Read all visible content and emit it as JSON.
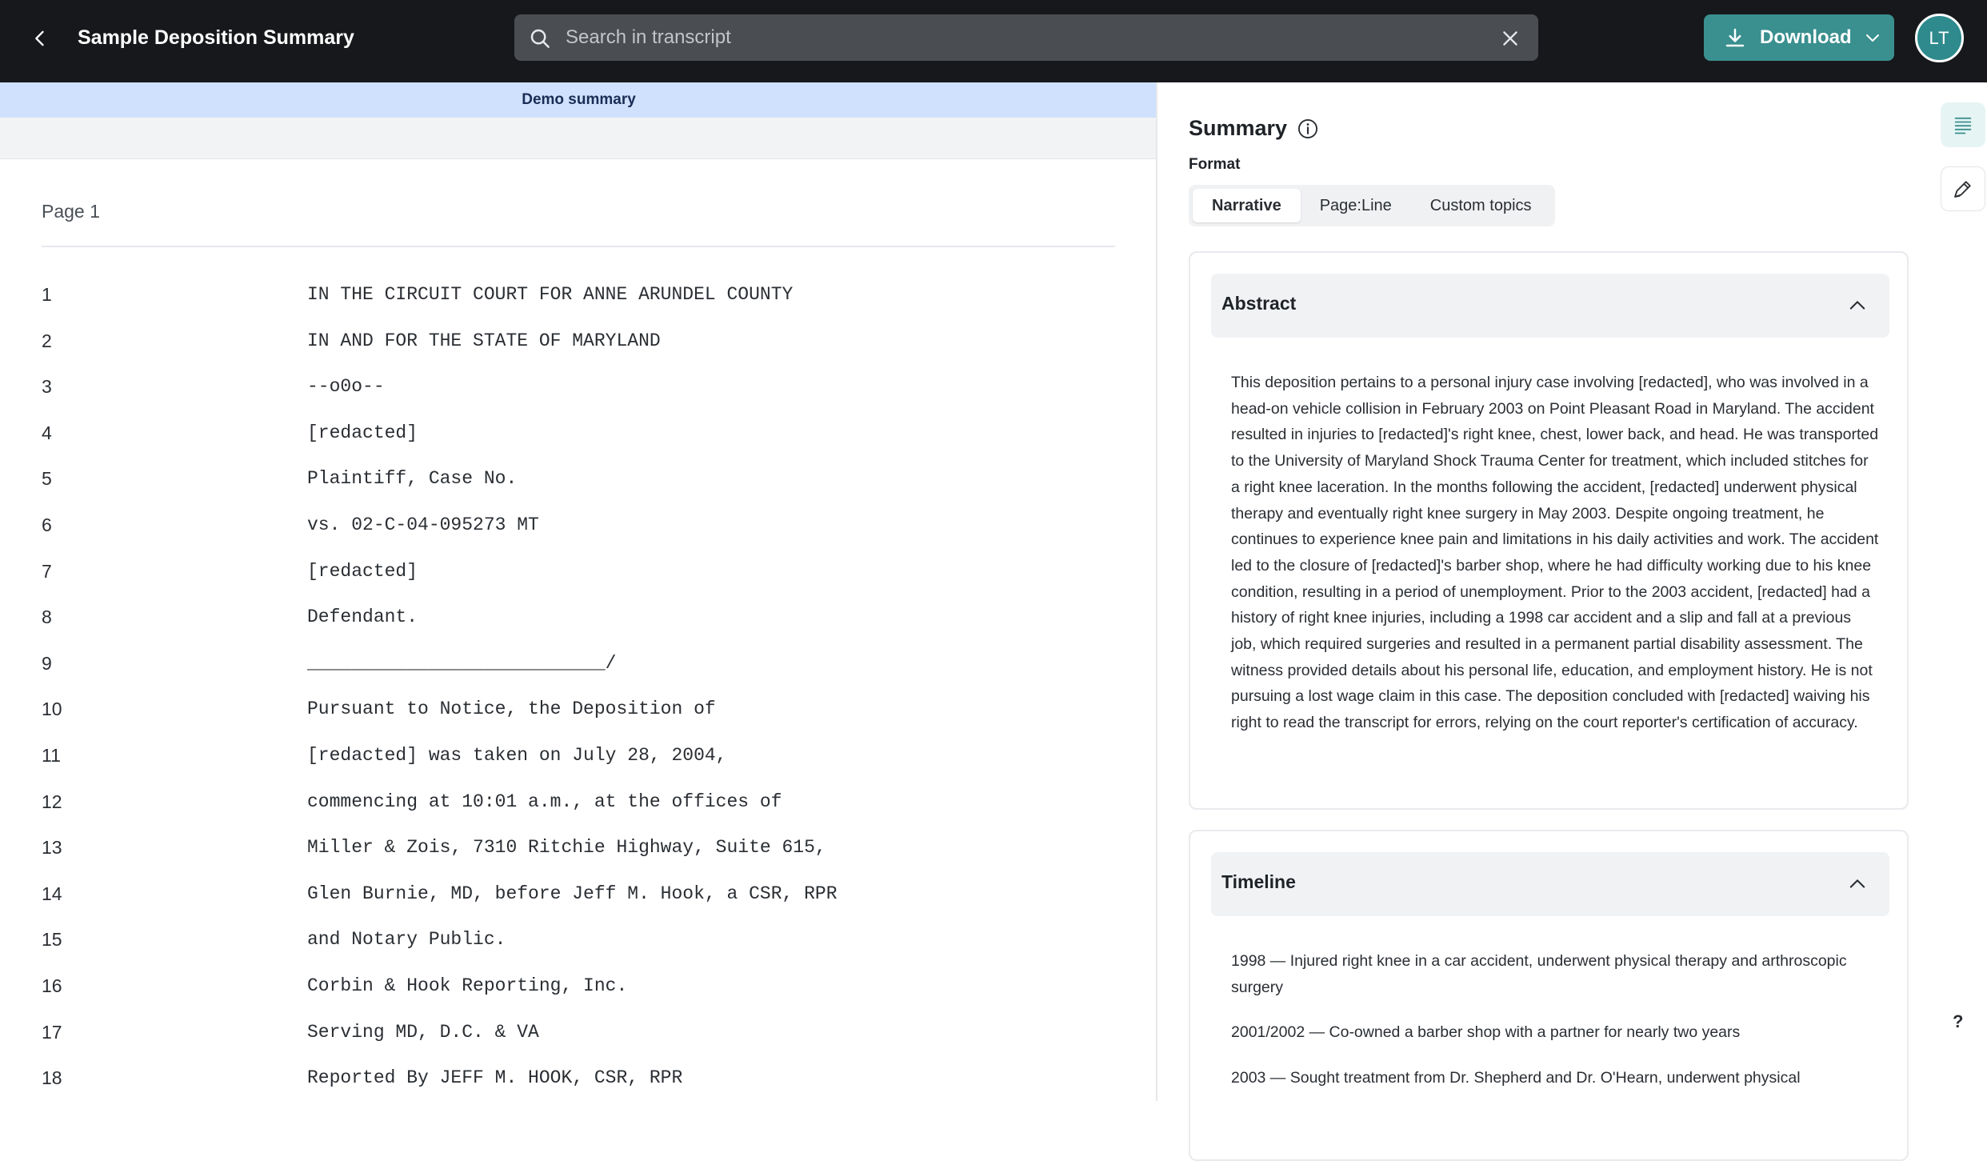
{
  "header": {
    "title": "Sample Deposition Summary",
    "search_placeholder": "Search in transcript",
    "download_label": "Download",
    "avatar_initials": "LT"
  },
  "transcript": {
    "banner": "Demo summary",
    "page_label": "Page 1",
    "lines": [
      {
        "num": "1",
        "text": "IN THE CIRCUIT COURT FOR ANNE ARUNDEL COUNTY"
      },
      {
        "num": "2",
        "text": "IN AND FOR THE STATE OF MARYLAND"
      },
      {
        "num": "3",
        "text": "--o0o--"
      },
      {
        "num": "4",
        "text": "[redacted]"
      },
      {
        "num": "5",
        "text": "Plaintiff, Case No."
      },
      {
        "num": "6",
        "text": "vs. 02-C-04-095273 MT"
      },
      {
        "num": "7",
        "text": "[redacted]"
      },
      {
        "num": "8",
        "text": "Defendant."
      },
      {
        "num": "9",
        "text": "___________________________/"
      },
      {
        "num": "10",
        "text": "Pursuant to Notice, the Deposition of"
      },
      {
        "num": "11",
        "text": "[redacted] was taken on July 28, 2004,"
      },
      {
        "num": "12",
        "text": "commencing at 10:01 a.m., at the offices of"
      },
      {
        "num": "13",
        "text": "Miller & Zois, 7310 Ritchie Highway, Suite 615,"
      },
      {
        "num": "14",
        "text": "Glen Burnie, MD, before Jeff M. Hook, a CSR, RPR"
      },
      {
        "num": "15",
        "text": "and Notary Public."
      },
      {
        "num": "16",
        "text": "Corbin & Hook Reporting, Inc."
      },
      {
        "num": "17",
        "text": "Serving MD, D.C. & VA"
      },
      {
        "num": "18",
        "text": "Reported By JEFF M. HOOK, CSR, RPR"
      }
    ]
  },
  "summary": {
    "title": "Summary",
    "format_label": "Format",
    "formats": [
      {
        "label": "Narrative",
        "active": true
      },
      {
        "label": "Page:Line",
        "active": false
      },
      {
        "label": "Custom topics",
        "active": false
      }
    ],
    "abstract": {
      "title": "Abstract",
      "text": "This deposition pertains to a personal injury case involving [redacted], who was involved in a head-on vehicle collision in February 2003 on Point Pleasant Road in Maryland. The accident resulted in injuries to [redacted]'s right knee, chest, lower back, and head. He was transported to the University of Maryland Shock Trauma Center for treatment, which included stitches for a right knee laceration. In the months following the accident, [redacted] underwent physical therapy and eventually right knee surgery in May 2003. Despite ongoing treatment, he continues to experience knee pain and limitations in his daily activities and work. The accident led to the closure of [redacted]'s barber shop, where he had difficulty working due to his knee condition, resulting in a period of unemployment. Prior to the 2003 accident, [redacted] had a history of right knee injuries, including a 1998 car accident and a slip and fall at a previous job, which required surgeries and resulted in a permanent partial disability assessment. The witness provided details about his personal life, education, and employment history. He is not pursuing a lost wage claim in this case. The deposition concluded with [redacted] waiving his right to read the transcript for errors, relying on the court reporter's certification of accuracy."
    },
    "timeline": {
      "title": "Timeline",
      "entries": [
        "1998 — Injured right knee in a car accident, underwent physical therapy and arthroscopic surgery",
        "2001/2002 — Co-owned a barber shop with a partner for nearly two years",
        "2003 — Sought treatment from Dr. Shepherd and Dr. O'Hearn, underwent physical"
      ]
    }
  },
  "rail": {
    "help_label": "?"
  },
  "colors": {
    "topbar": "#16181b",
    "accent": "#3a8f8f",
    "banner": "#cfe1fd"
  }
}
